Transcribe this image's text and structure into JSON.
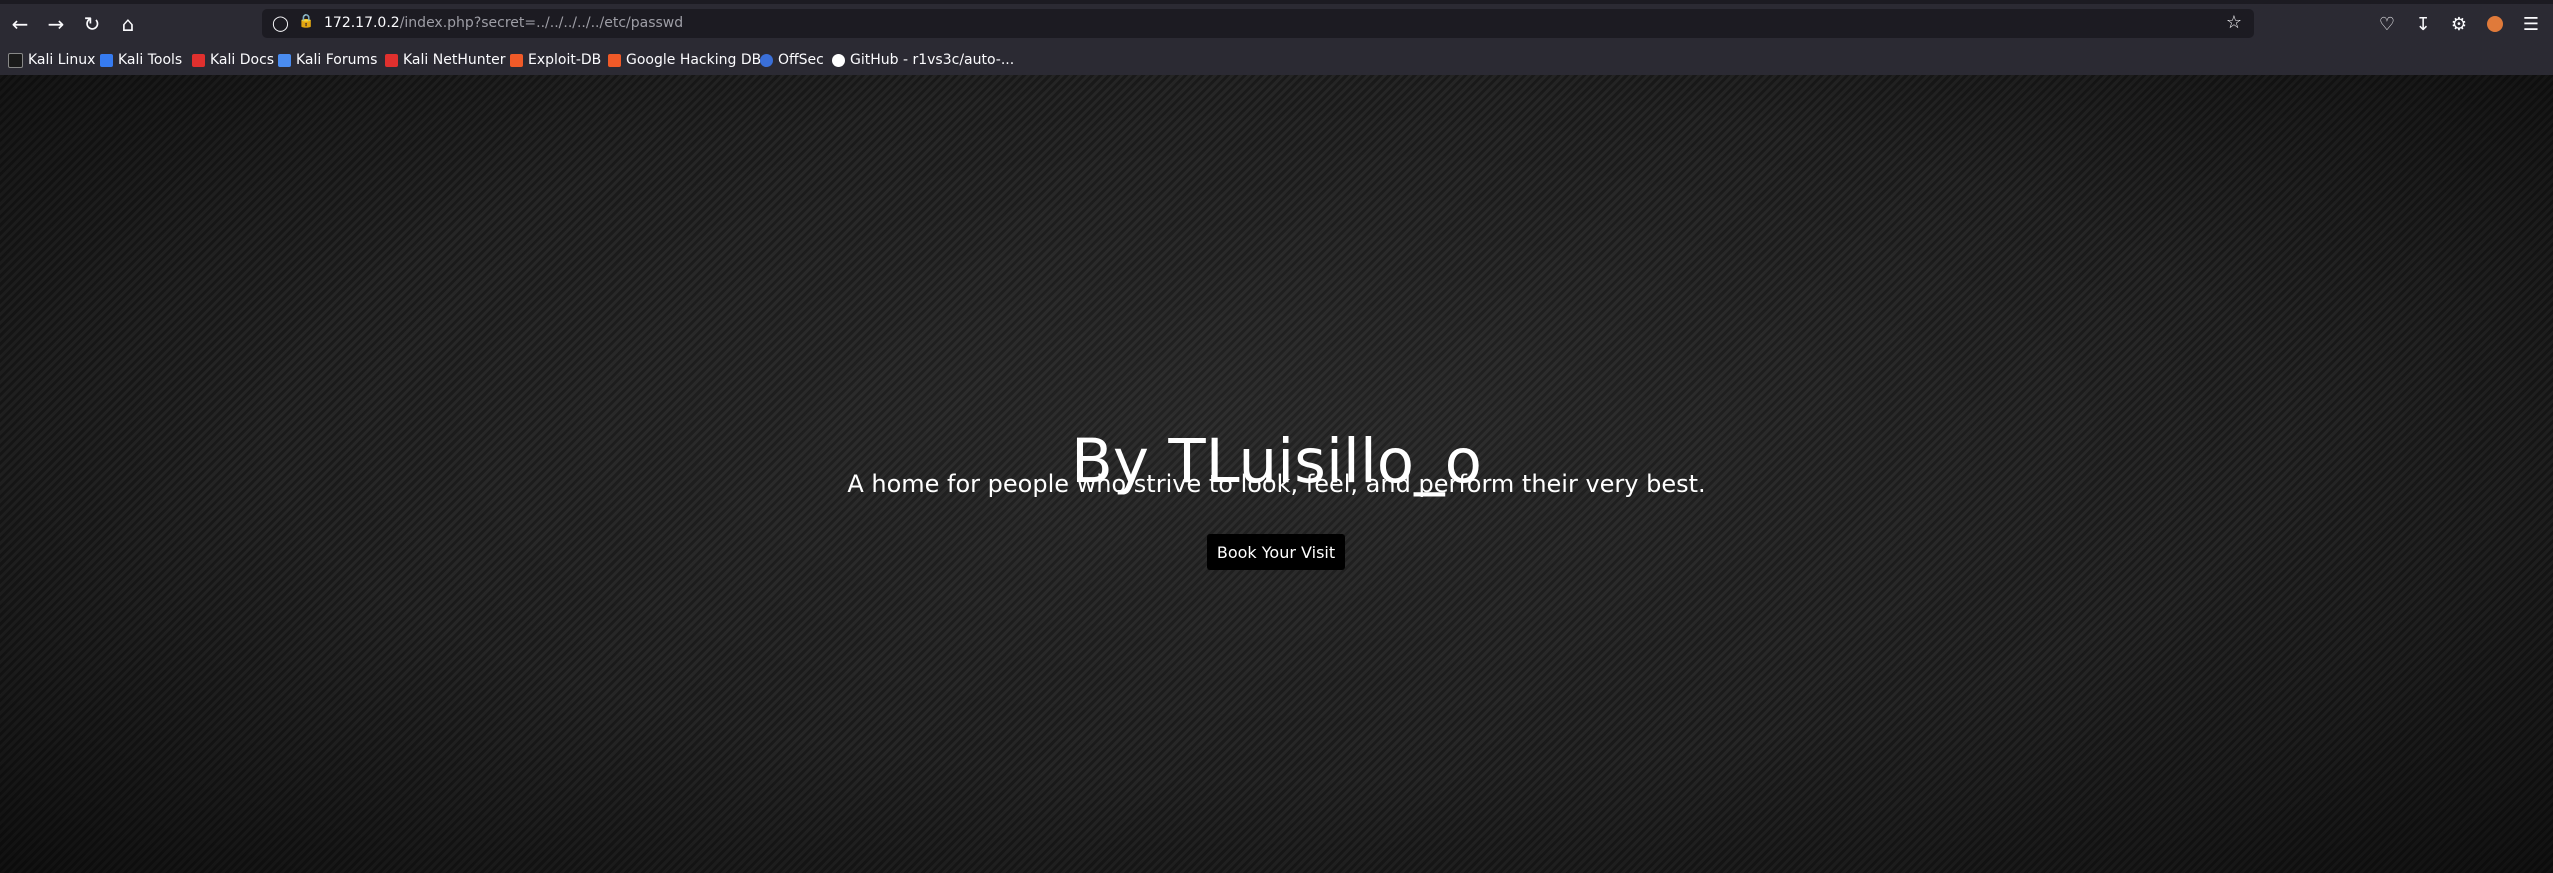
{
  "browser": {
    "url_host": "172.17.0.2",
    "url_path": "/index.php?secret=../../../../../etc/passwd",
    "bookmarks": [
      {
        "label": "Kali Linux",
        "icon": "kali-linux-icon",
        "color": "#367bf0"
      },
      {
        "label": "Kali Tools",
        "icon": "kali-tools-icon",
        "color": "#367bf0"
      },
      {
        "label": "Kali Docs",
        "icon": "kali-docs-icon",
        "color": "#e0302e"
      },
      {
        "label": "Kali Forums",
        "icon": "kali-forums-icon",
        "color": "#4a8cf0"
      },
      {
        "label": "Kali NetHunter",
        "icon": "kali-nethunter-icon",
        "color": "#e0302e"
      },
      {
        "label": "Exploit-DB",
        "icon": "exploit-db-icon",
        "color": "#f05a28"
      },
      {
        "label": "Google Hacking DB",
        "icon": "ghdb-icon",
        "color": "#f05a28"
      },
      {
        "label": "OffSec",
        "icon": "offsec-icon",
        "color": "#3a6fd8"
      },
      {
        "label": "GitHub - r1vs3c/auto-...",
        "icon": "github-icon",
        "color": "#ffffff"
      }
    ]
  },
  "hero": {
    "title": "By TLuisillo_o",
    "subtitle": "A home for people who strive to look, feel, and perform their very best.",
    "cta_label": "Book Your Visit"
  },
  "colors": {
    "toolbar": "#2b2a33",
    "urlbar": "#1c1b22",
    "button": "#000000"
  }
}
